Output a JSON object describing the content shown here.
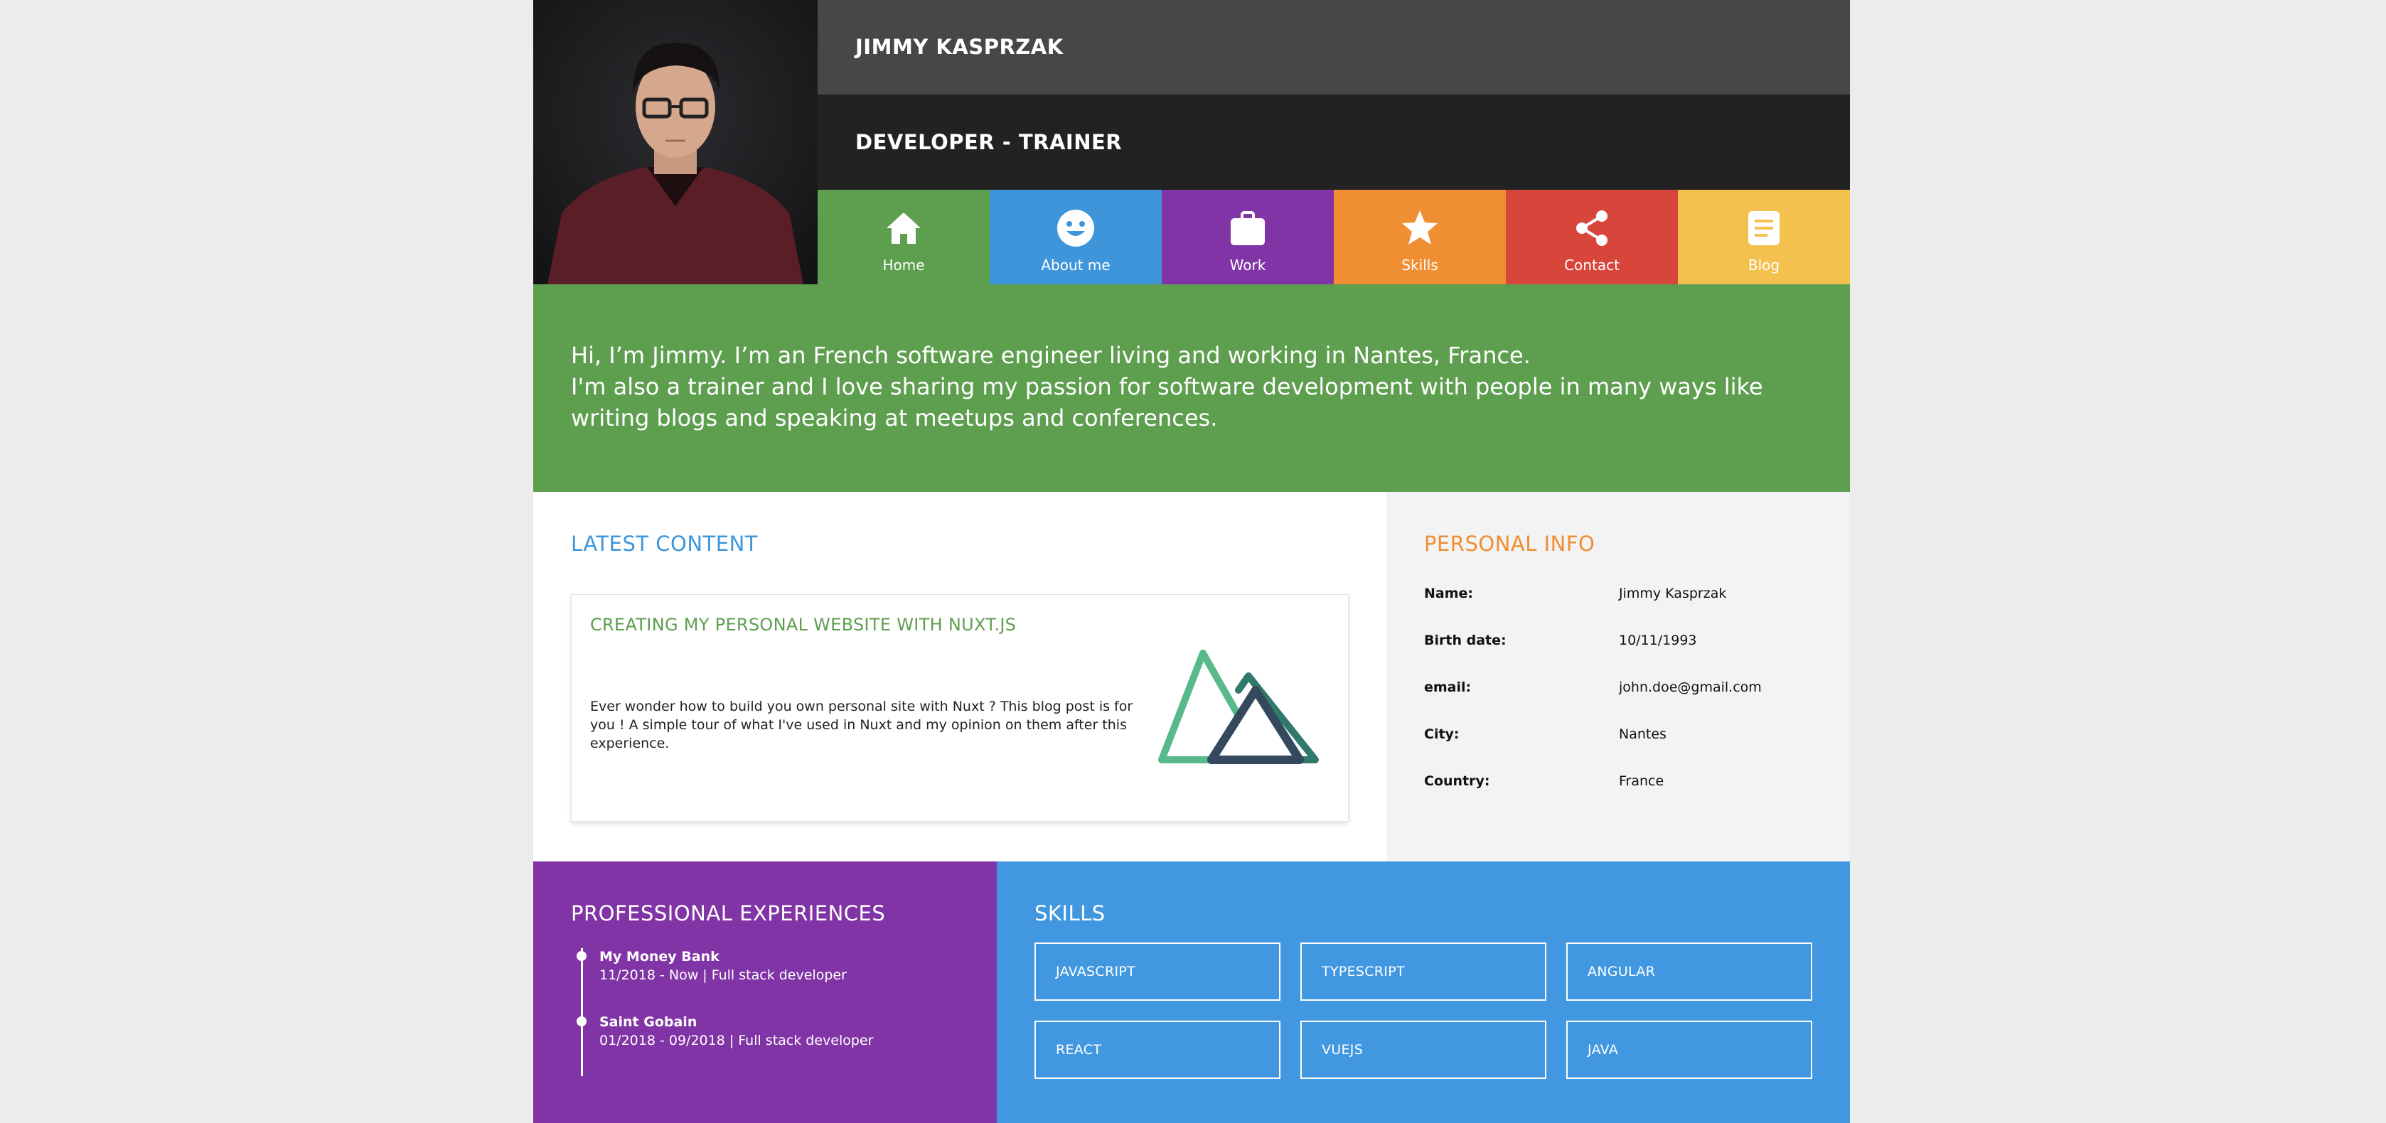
{
  "header": {
    "name": "JIMMY KASPRZAK",
    "role": "DEVELOPER - TRAINER"
  },
  "nav": [
    {
      "label": "Home",
      "icon": "home-icon",
      "color": "#5e9e4f"
    },
    {
      "label": "About me",
      "icon": "smiley-icon",
      "color": "#3e95d9"
    },
    {
      "label": "Work",
      "icon": "briefcase-icon",
      "color": "#8134a5"
    },
    {
      "label": "Skills",
      "icon": "star-icon",
      "color": "#ef8e33"
    },
    {
      "label": "Contact",
      "icon": "share-icon",
      "color": "#d8453b"
    },
    {
      "label": "Blog",
      "icon": "document-icon",
      "color": "#f4c14f"
    }
  ],
  "intro": {
    "line1": "Hi, I’m Jimmy. I’m an French software engineer living and working in Nantes, France.",
    "line2": "I'm also a trainer and I love sharing my passion for software development with people in many ways like writing blogs and speaking at meetups and conferences."
  },
  "latest": {
    "title": "LATEST CONTENT",
    "post_title": "CREATING MY PERSONAL WEBSITE WITH NUXT.JS",
    "post_text": "Ever wonder how to build you own personal site with Nuxt ? This blog post is for you ! A simple tour of what I've used in Nuxt and my opinion on them after this experience."
  },
  "info": {
    "title": "PERSONAL INFO",
    "rows": [
      {
        "label": "Name:",
        "value": "Jimmy Kasprzak"
      },
      {
        "label": "Birth date:",
        "value": "10/11/1993"
      },
      {
        "label": "email:",
        "value": "john.doe@gmail.com"
      },
      {
        "label": "City:",
        "value": "Nantes"
      },
      {
        "label": "Country:",
        "value": "France"
      }
    ]
  },
  "experiences": {
    "title": "PROFESSIONAL EXPERIENCES",
    "items": [
      {
        "company": "My Money Bank",
        "period": "11/2018 - Now | Full stack developer"
      },
      {
        "company": "Saint Gobain",
        "period": "01/2018 - 09/2018 | Full stack developer"
      }
    ]
  },
  "skills": {
    "title": "SKILLS",
    "items": [
      "JAVASCRIPT",
      "TYPESCRIPT",
      "ANGULAR",
      "REACT",
      "VUEJS",
      "JAVA"
    ]
  }
}
